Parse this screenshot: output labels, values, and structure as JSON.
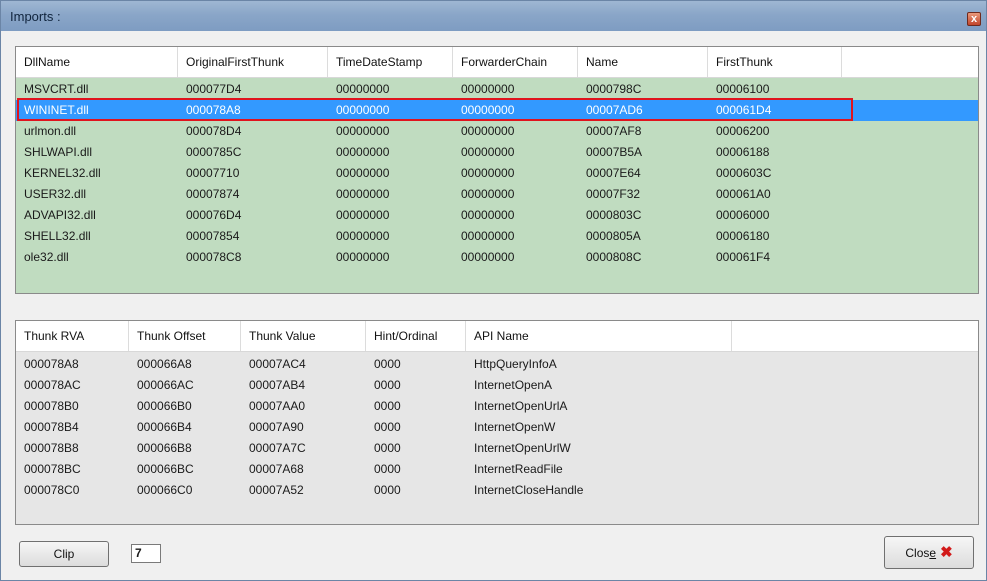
{
  "window": {
    "title": "Imports :",
    "close_glyph": "x"
  },
  "dll_table": {
    "columns": [
      "DllName",
      "OriginalFirstThunk",
      "TimeDateStamp",
      "ForwarderChain",
      "Name",
      "FirstThunk"
    ],
    "rows": [
      [
        "MSVCRT.dll",
        "000077D4",
        "00000000",
        "00000000",
        "0000798C",
        "00006100"
      ],
      [
        "WININET.dll",
        "000078A8",
        "00000000",
        "00000000",
        "00007AD6",
        "000061D4"
      ],
      [
        "urlmon.dll",
        "000078D4",
        "00000000",
        "00000000",
        "00007AF8",
        "00006200"
      ],
      [
        "SHLWAPI.dll",
        "0000785C",
        "00000000",
        "00000000",
        "00007B5A",
        "00006188"
      ],
      [
        "KERNEL32.dll",
        "00007710",
        "00000000",
        "00000000",
        "00007E64",
        "0000603C"
      ],
      [
        "USER32.dll",
        "00007874",
        "00000000",
        "00000000",
        "00007F32",
        "000061A0"
      ],
      [
        "ADVAPI32.dll",
        "000076D4",
        "00000000",
        "00000000",
        "0000803C",
        "00006000"
      ],
      [
        "SHELL32.dll",
        "00007854",
        "00000000",
        "00000000",
        "0000805A",
        "00006180"
      ],
      [
        "ole32.dll",
        "000078C8",
        "00000000",
        "00000000",
        "0000808C",
        "000061F4"
      ]
    ],
    "selected_row": "WININET.dll"
  },
  "thunk_table": {
    "columns": [
      "Thunk RVA",
      "Thunk Offset",
      "Thunk Value",
      "Hint/Ordinal",
      "API Name"
    ],
    "rows": [
      [
        "000078A8",
        "000066A8",
        "00007AC4",
        "0000",
        "HttpQueryInfoA"
      ],
      [
        "000078AC",
        "000066AC",
        "00007AB4",
        "0000",
        "InternetOpenA"
      ],
      [
        "000078B0",
        "000066B0",
        "00007AA0",
        "0000",
        "InternetOpenUrlA"
      ],
      [
        "000078B4",
        "000066B4",
        "00007A90",
        "0000",
        "InternetOpenW"
      ],
      [
        "000078B8",
        "000066B8",
        "00007A7C",
        "0000",
        "InternetOpenUrlW"
      ],
      [
        "000078BC",
        "000066BC",
        "00007A68",
        "0000",
        "InternetReadFile"
      ],
      [
        "000078C0",
        "000066C0",
        "00007A52",
        "0000",
        "InternetCloseHandle"
      ]
    ]
  },
  "footer": {
    "clip_label": "Clip",
    "count_value": "7",
    "close_label_prefix": "Clos",
    "close_label_hotkey": "e",
    "close_icon": "close-x-icon"
  },
  "colors": {
    "dll_panel_bg": "#c0dcc0",
    "selection": "#3399ff",
    "highlight_outline": "#e0141e",
    "thunk_panel_bg": "#e6e6e6"
  }
}
